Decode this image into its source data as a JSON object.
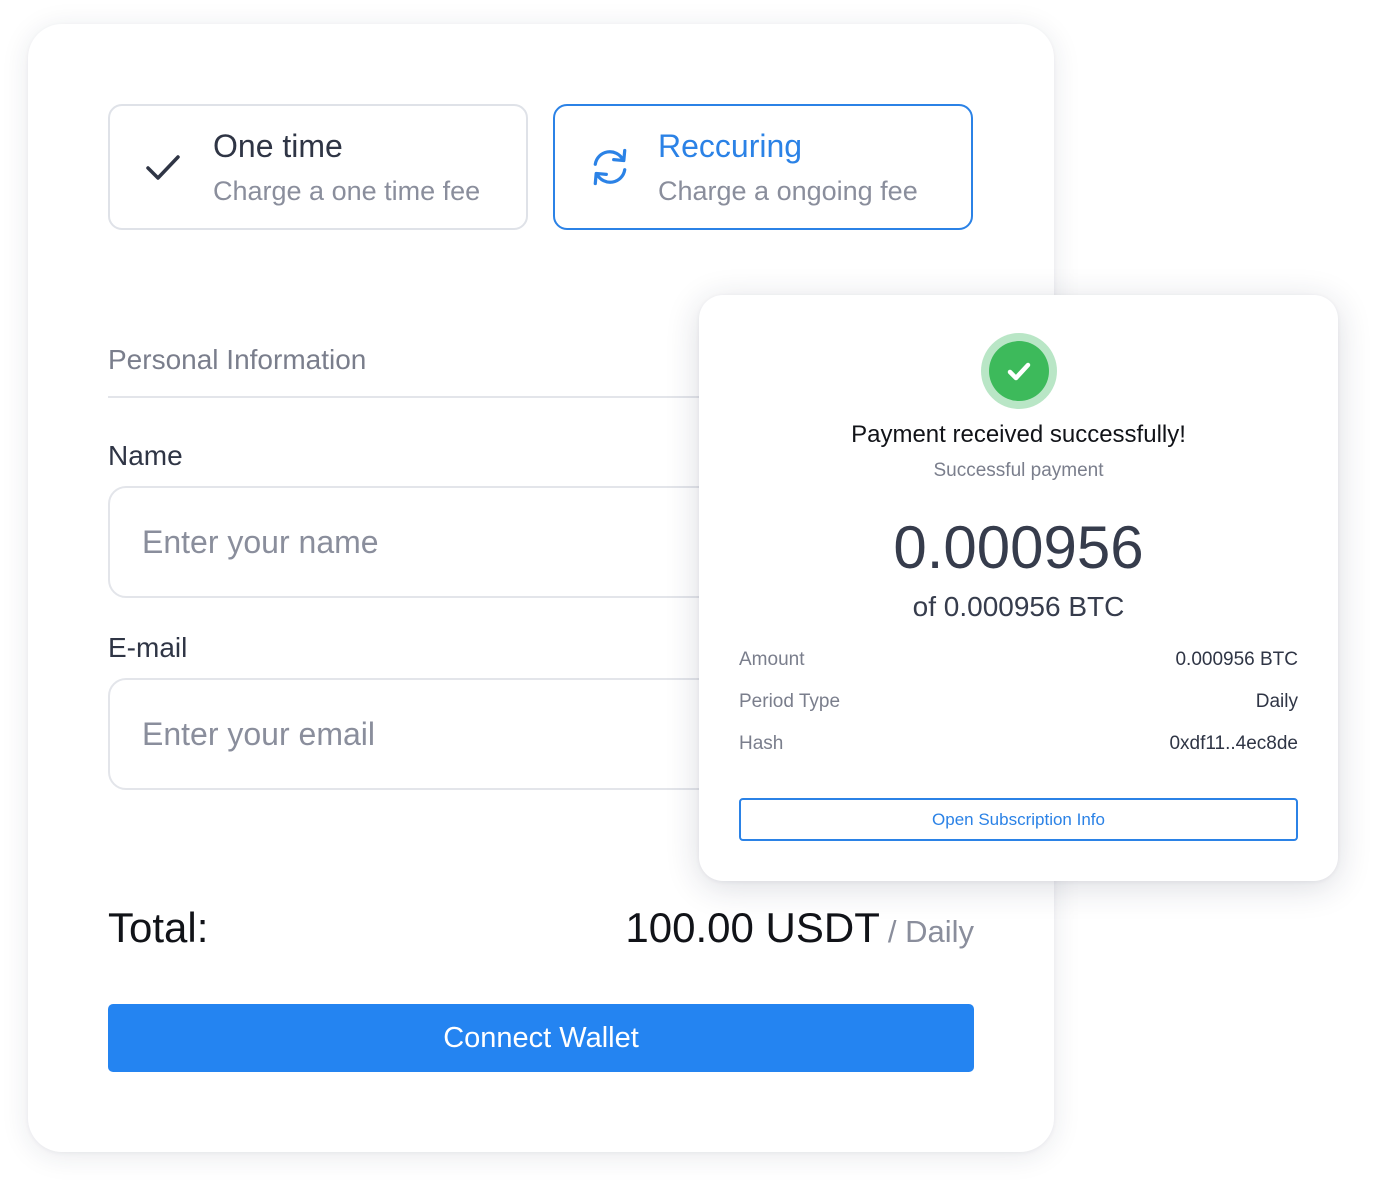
{
  "plans": {
    "one_time": {
      "title": "One time",
      "description": "Charge a one time fee",
      "icon": "check-icon"
    },
    "recurring": {
      "title": "Reccuring",
      "description": "Charge a ongoing fee",
      "icon": "refresh-icon",
      "selected": true
    }
  },
  "form": {
    "section_title": "Personal Information",
    "name": {
      "label": "Name",
      "placeholder": "Enter your name",
      "value": ""
    },
    "email": {
      "label": "E-mail",
      "placeholder": "Enter your email",
      "value": ""
    }
  },
  "total": {
    "label": "Total:",
    "amount": "100.00 USDT",
    "period": "/ Daily"
  },
  "connect_button": {
    "label": "Connect Wallet"
  },
  "payment_success": {
    "icon": "success-check-icon",
    "title": "Payment received successfully!",
    "subtitle": "Successful payment",
    "amount": "0.000956",
    "amount_of": "of 0.000956 BTC",
    "details": [
      {
        "key": "Amount",
        "value": "0.000956 BTC"
      },
      {
        "key": "Period Type",
        "value": "Daily"
      },
      {
        "key": "Hash",
        "value": "0xdf11..4ec8de"
      }
    ],
    "button_label": "Open Subscription Info"
  },
  "colors": {
    "accent": "#2b82e6",
    "button_primary": "#2484f1",
    "success": "#3dba5b",
    "success_ring": "#b9e6c6",
    "text_dark": "#2f3545",
    "text_muted": "#8a8e9c"
  }
}
